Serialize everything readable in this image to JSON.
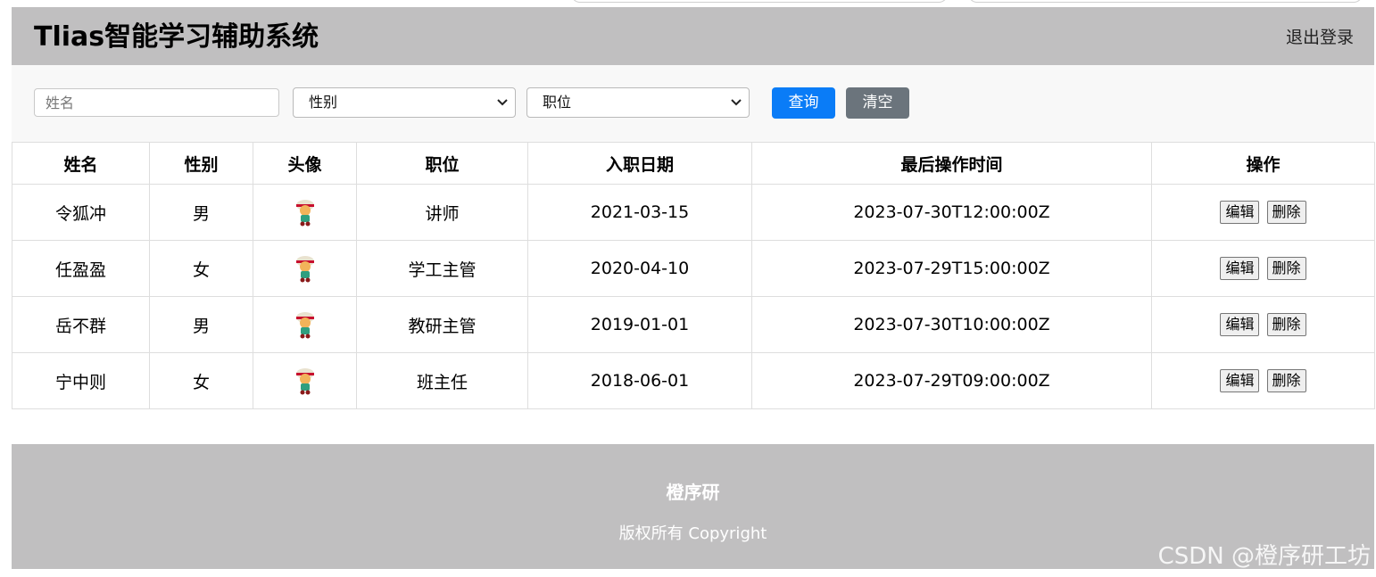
{
  "header": {
    "title": "Tlias智能学习辅助系统",
    "logout_label": "退出登录"
  },
  "filters": {
    "name_placeholder": "姓名",
    "gender_selected": "性别",
    "job_selected": "职位",
    "query_label": "查询",
    "clear_label": "清空"
  },
  "table": {
    "columns": [
      "姓名",
      "性别",
      "头像",
      "职位",
      "入职日期",
      "最后操作时间",
      "操作"
    ],
    "rows": [
      {
        "name": "令狐冲",
        "gender": "男",
        "avatar": "avatar-image",
        "job": "讲师",
        "entry_date": "2021-03-15",
        "update_time": "2023-07-30T12:00:00Z"
      },
      {
        "name": "任盈盈",
        "gender": "女",
        "avatar": "avatar-image",
        "job": "学工主管",
        "entry_date": "2020-04-10",
        "update_time": "2023-07-29T15:00:00Z"
      },
      {
        "name": "岳不群",
        "gender": "男",
        "avatar": "avatar-image",
        "job": "教研主管",
        "entry_date": "2019-01-01",
        "update_time": "2023-07-30T10:00:00Z"
      },
      {
        "name": "宁中则",
        "gender": "女",
        "avatar": "avatar-image",
        "job": "班主任",
        "entry_date": "2018-06-01",
        "update_time": "2023-07-29T09:00:00Z"
      }
    ],
    "edit_label": "编辑",
    "delete_label": "删除"
  },
  "footer": {
    "company": "橙序研",
    "copyright": "版权所有 Copyright"
  },
  "watermark": "CSDN @橙序研工坊",
  "colors": {
    "header_bg": "#c0bfc0",
    "filter_bg": "#f8f8f8",
    "query_btn": "#0a7cf7",
    "clear_btn": "#6b747c"
  }
}
